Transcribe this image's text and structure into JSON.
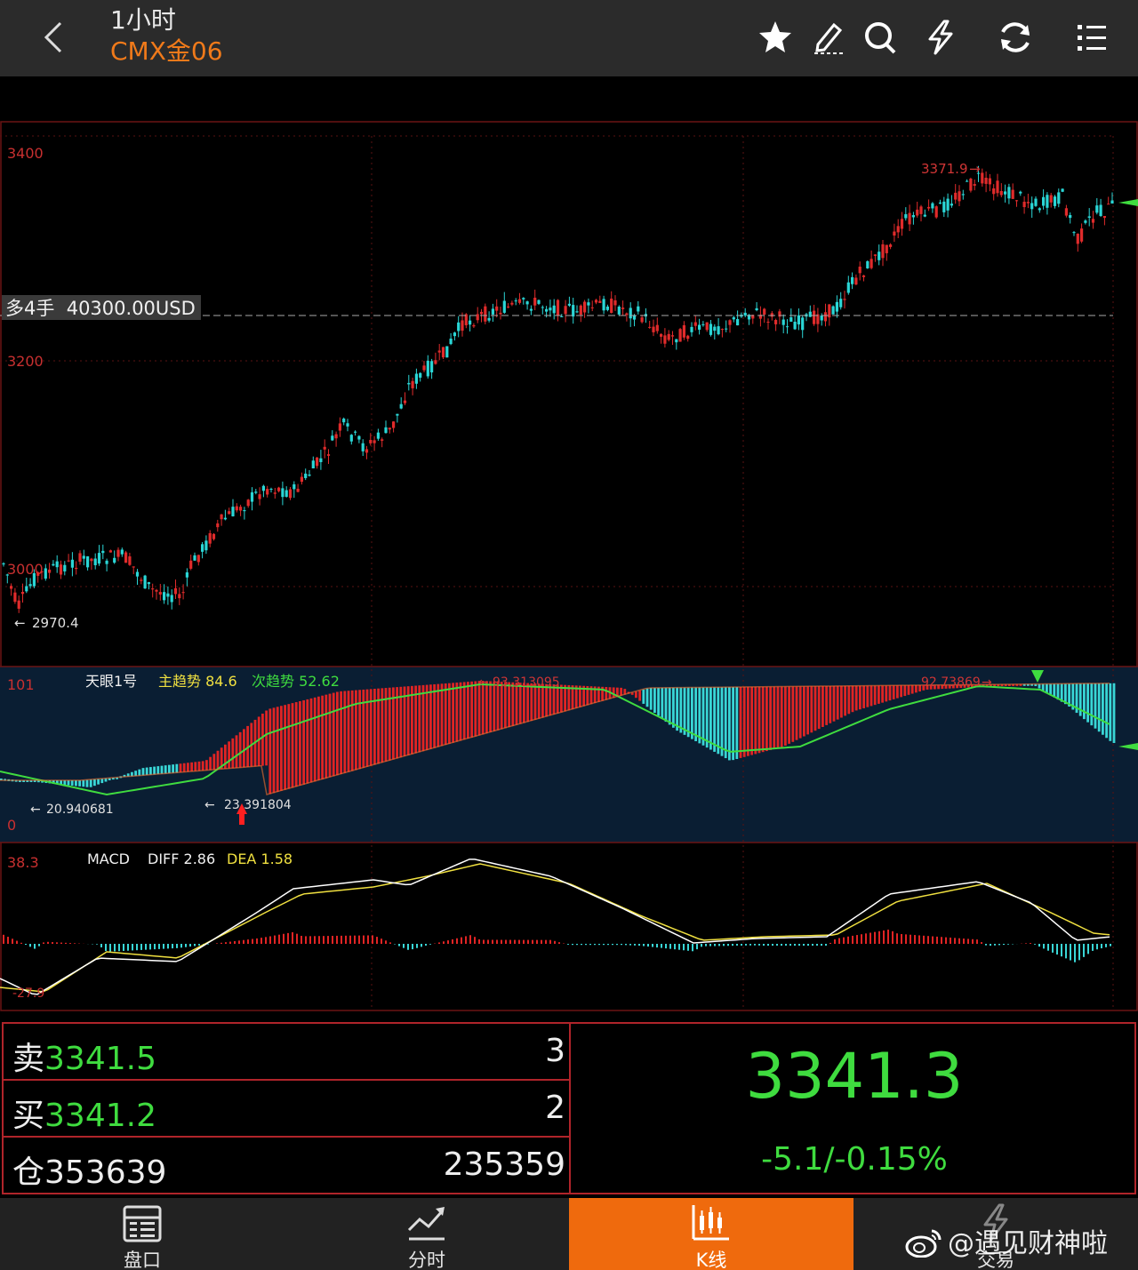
{
  "header": {
    "period": "1小时",
    "symbol": "CMX金06",
    "icons": [
      "back-icon",
      "star-icon",
      "draw-icon",
      "search-icon",
      "flash-icon",
      "refresh-icon",
      "menu-icon"
    ]
  },
  "main_chart": {
    "y_ticks": [
      "3400",
      "3200",
      "3000"
    ],
    "high_label": "3371.9",
    "low_label": "2970.4",
    "position_line": "多4手  40300.00USD"
  },
  "indicator1": {
    "name": "天眼1号",
    "main_trend_label": "主趋势 84.6",
    "sub_trend_label": "次趋势 52.62",
    "y_top": "101",
    "y_bottom": "0",
    "annot_high1": "93.313095",
    "annot_high2": "92.73869",
    "annot_low1": "20.940681",
    "annot_low2": "23.391804"
  },
  "indicator2": {
    "name": "MACD",
    "diff_label": "DIFF 2.86",
    "dea_label": "DEA 1.58",
    "y_top": "38.3",
    "y_bottom": "-27.9"
  },
  "quote": {
    "sell_label": "卖",
    "sell_price": "3341.5",
    "sell_qty": "3",
    "buy_label": "买",
    "buy_price": "3341.2",
    "buy_qty": "2",
    "oi_label": "仓353639",
    "volume": "235359",
    "last_price": "3341.3",
    "change": "-5.1/-0.15%"
  },
  "nav": {
    "items": [
      {
        "label": "盘口",
        "icon": "orderbook-icon"
      },
      {
        "label": "分时",
        "icon": "timeshare-icon"
      },
      {
        "label": "K线",
        "icon": "candlestick-icon"
      },
      {
        "label": "交易",
        "icon": "trade-icon"
      }
    ],
    "active_index": 2
  },
  "watermark": "@遇见财神啦",
  "colors": {
    "up": "#e02b2b",
    "down": "#2ad6d6",
    "accent": "#ef6a0d",
    "price_green": "#3fdc3f",
    "grid_red": "#7a1515"
  }
}
